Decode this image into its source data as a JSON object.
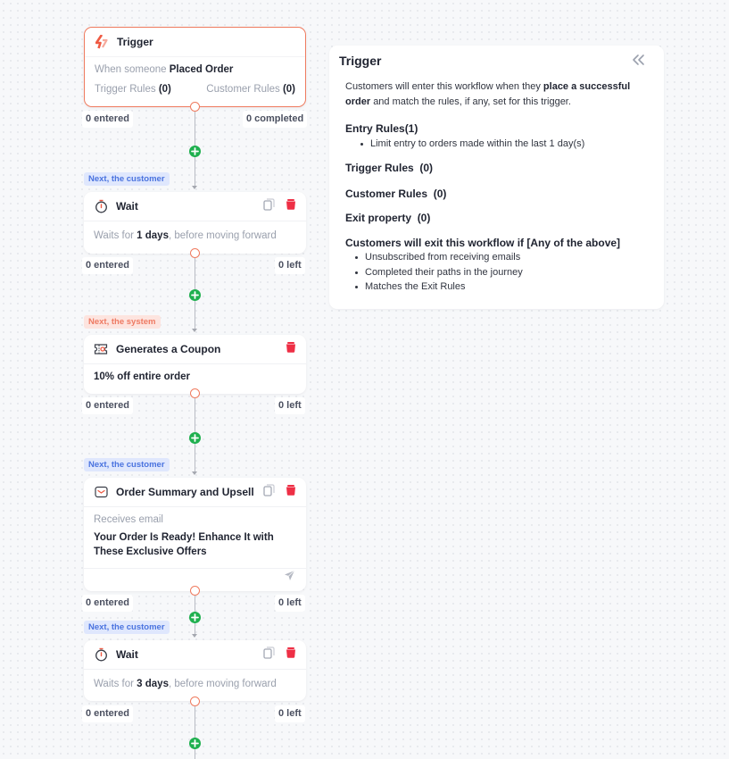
{
  "colors": {
    "accent_orange": "#ef7b5f",
    "add_green": "#1fb04f",
    "delete_red": "#ee2f45",
    "tag_customer_bg": "#dfe7fd",
    "tag_customer_text": "#4a73df",
    "tag_system_bg": "#fde4df",
    "tag_system_text": "#ee7a63"
  },
  "workflow": {
    "trigger": {
      "icon": "lightning-icon",
      "title": "Trigger",
      "event_prefix": "When someone",
      "event_name": "Placed Order",
      "trigger_rules_label": "Trigger Rules",
      "trigger_rules_count": "(0)",
      "customer_rules_label": "Customer Rules",
      "customer_rules_count": "(0)",
      "entered": "0 entered",
      "completed": "0 completed"
    },
    "steps": [
      {
        "tag": "Next, the customer",
        "tag_type": "customer",
        "icon": "stopwatch-icon",
        "title": "Wait",
        "body_prefix": "Waits for",
        "body_value": "1 days",
        "body_suffix": ", before moving forward",
        "entered": "0 entered",
        "left": "0 left"
      },
      {
        "tag": "Next, the system",
        "tag_type": "system",
        "icon": "coupon-icon",
        "title": "Generates a Coupon",
        "body": "10% off entire order",
        "entered": "0 entered",
        "left": "0 left"
      },
      {
        "tag": "Next, the customer",
        "tag_type": "customer",
        "icon": "email-icon",
        "title": "Order Summary and Upsell",
        "body_label": "Receives email",
        "body_subject": "Your Order Is Ready! Enhance It with These Exclusive Offers",
        "entered": "0 entered",
        "left": "0 left"
      },
      {
        "tag": "Next, the customer",
        "tag_type": "customer",
        "icon": "stopwatch-icon",
        "title": "Wait",
        "body_prefix": "Waits for",
        "body_value": "3 days",
        "body_suffix": ", before moving forward",
        "entered": "0 entered",
        "left": "0 left"
      }
    ]
  },
  "panel": {
    "title": "Trigger",
    "intro_prefix": "Customers will enter this workflow when they",
    "intro_bold": "place a successful order",
    "intro_suffix": "and match the rules, if any, set for this trigger.",
    "entry_rules_label": "Entry Rules",
    "entry_rules_count": "(1)",
    "entry_rules": [
      "Limit entry to orders made within the last 1 day(s)"
    ],
    "trigger_rules_label": "Trigger Rules",
    "trigger_rules_count": "(0)",
    "customer_rules_label": "Customer Rules",
    "customer_rules_count": "(0)",
    "exit_property_label": "Exit property",
    "exit_property_count": "(0)",
    "exit_heading": "Customers will exit this workflow if [Any of the above]",
    "exit_conditions": [
      "Unsubscribed from receiving emails",
      "Completed their paths in the journey",
      "Matches the Exit Rules"
    ]
  }
}
